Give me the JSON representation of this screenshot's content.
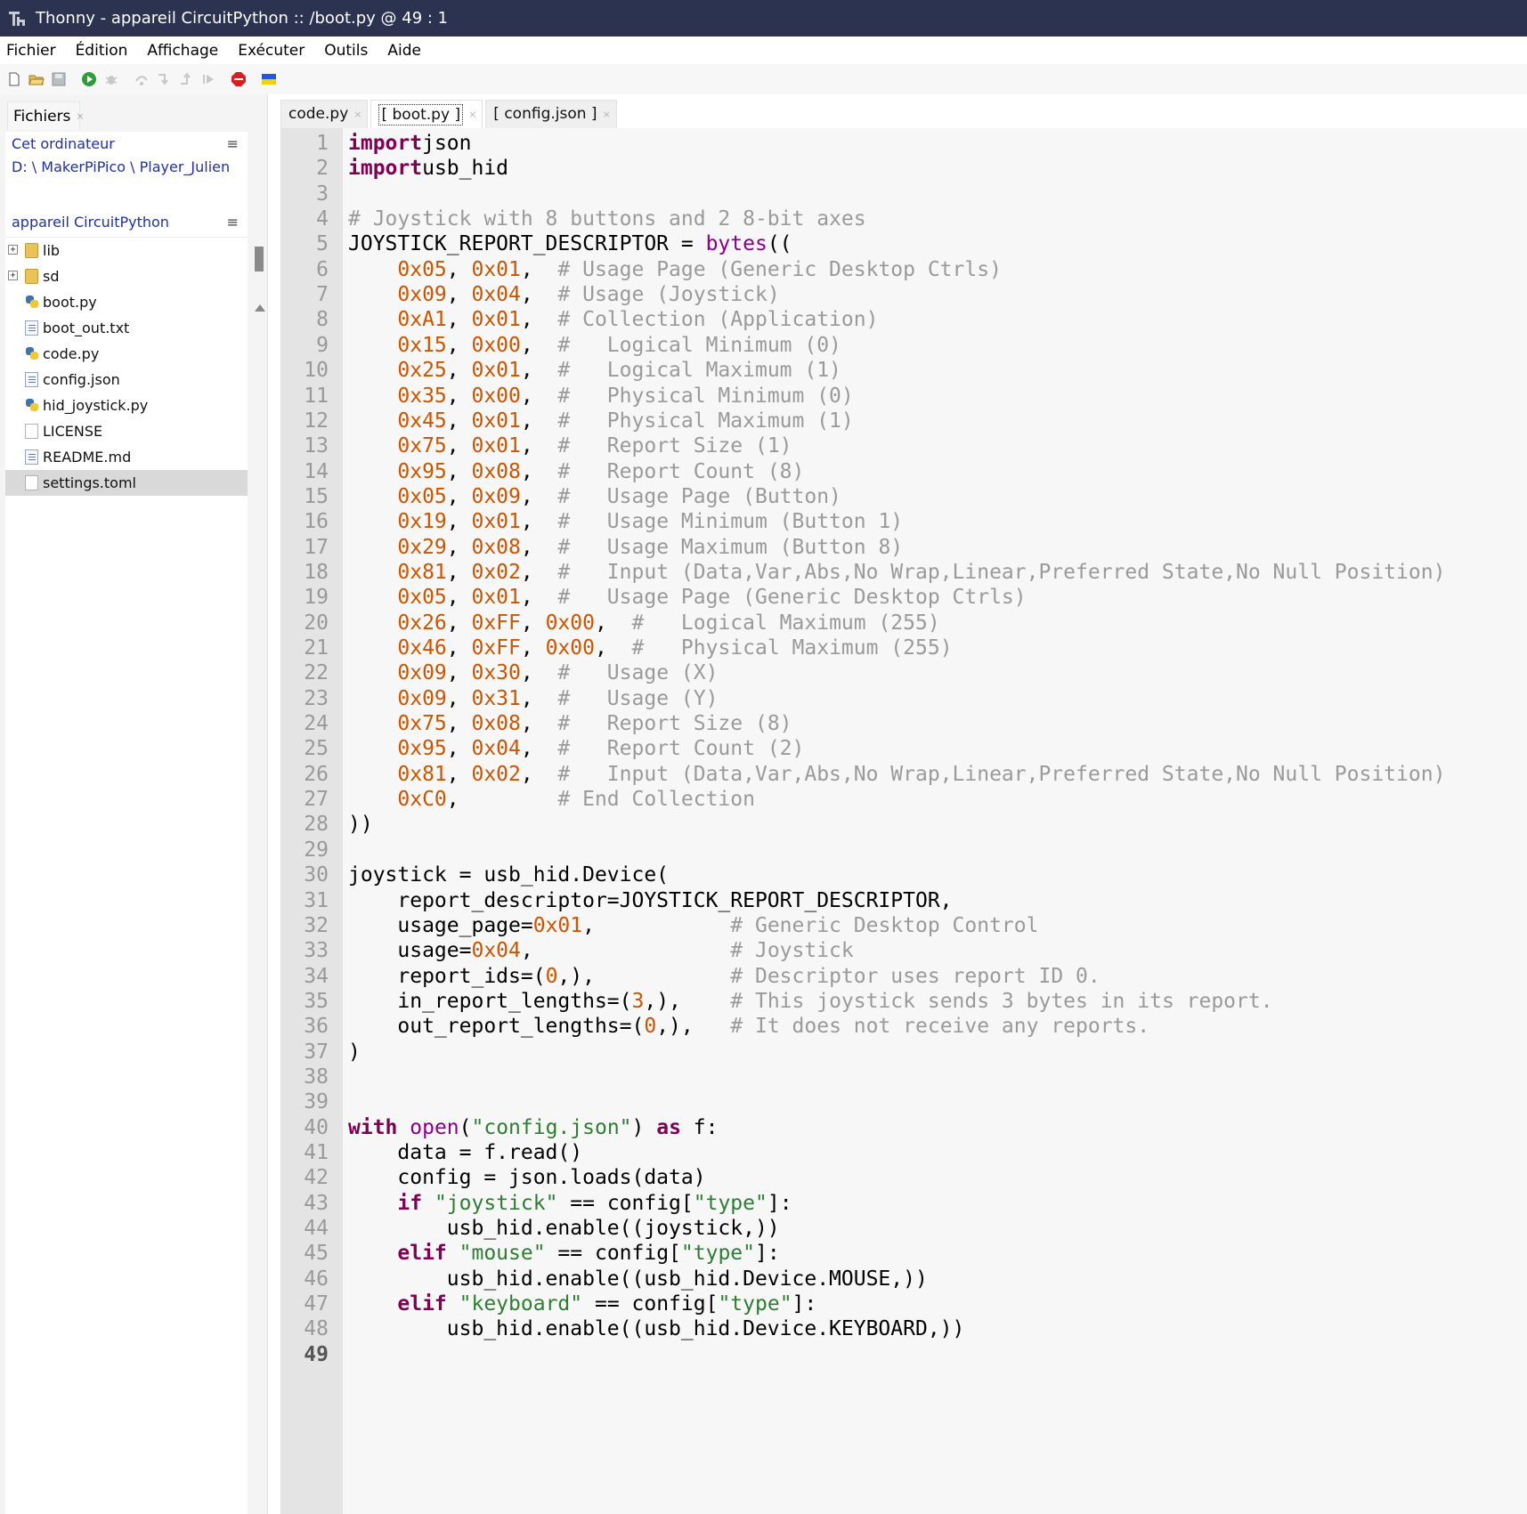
{
  "window": {
    "title": "Thonny  -  appareil CircuitPython :: /boot.py  @  49 : 1"
  },
  "menu": [
    "Fichier",
    "Édition",
    "Affichage",
    "Exécuter",
    "Outils",
    "Aide"
  ],
  "toolbar": {
    "icons": [
      "new-file-icon",
      "open-file-icon",
      "save-icon",
      "run-icon",
      "debug-icon",
      "step-over-icon",
      "step-into-icon",
      "step-out-icon",
      "resume-icon",
      "stop-icon",
      "ukraine-flag-icon"
    ]
  },
  "files_panel": {
    "tab_label": "Fichiers",
    "tab_close": "×",
    "local": {
      "title": "Cet ordinateur",
      "path": "D: \\ MakerPiPico \\ Player_Julien",
      "menu": "≡"
    },
    "device": {
      "title": "appareil CircuitPython",
      "menu": "≡",
      "items": [
        {
          "name": "lib",
          "type": "folder",
          "expander": "+"
        },
        {
          "name": "sd",
          "type": "folder",
          "expander": "+"
        },
        {
          "name": "boot.py",
          "type": "py"
        },
        {
          "name": "boot_out.txt",
          "type": "doc"
        },
        {
          "name": "code.py",
          "type": "py"
        },
        {
          "name": "config.json",
          "type": "doc"
        },
        {
          "name": "hid_joystick.py",
          "type": "py"
        },
        {
          "name": "LICENSE",
          "type": "blank"
        },
        {
          "name": "README.md",
          "type": "doc"
        },
        {
          "name": "settings.toml",
          "type": "blank",
          "selected": true
        }
      ]
    }
  },
  "editor": {
    "tabs": [
      {
        "label": "code.py",
        "active": false,
        "close": "×"
      },
      {
        "label": "[ boot.py ]",
        "active": true,
        "close": "×"
      },
      {
        "label": "[ config.json ]",
        "active": false,
        "close": "×"
      }
    ],
    "current_line": 49,
    "lines": [
      [
        [
          "kw",
          "import"
        ],
        [
          "",
          "json"
        ]
      ],
      [
        [
          "kw",
          "import"
        ],
        [
          "",
          "usb_hid"
        ]
      ],
      [],
      [
        [
          "cmt",
          "# Joystick with 8 buttons and 2 8-bit axes"
        ]
      ],
      [
        [
          "",
          "JOYSTICK_REPORT_DESCRIPTOR = "
        ],
        [
          "bi",
          "bytes"
        ],
        [
          "",
          "(("
        ]
      ],
      [
        [
          "",
          "    "
        ],
        [
          "num",
          "0x05"
        ],
        [
          "",
          ", "
        ],
        [
          "num",
          "0x01"
        ],
        [
          "",
          ",  "
        ],
        [
          "cmt",
          "# Usage Page (Generic Desktop Ctrls)"
        ]
      ],
      [
        [
          "",
          "    "
        ],
        [
          "num",
          "0x09"
        ],
        [
          "",
          ", "
        ],
        [
          "num",
          "0x04"
        ],
        [
          "",
          ",  "
        ],
        [
          "cmt",
          "# Usage (Joystick)"
        ]
      ],
      [
        [
          "",
          "    "
        ],
        [
          "num",
          "0xA1"
        ],
        [
          "",
          ", "
        ],
        [
          "num",
          "0x01"
        ],
        [
          "",
          ",  "
        ],
        [
          "cmt",
          "# Collection (Application)"
        ]
      ],
      [
        [
          "",
          "    "
        ],
        [
          "num",
          "0x15"
        ],
        [
          "",
          ", "
        ],
        [
          "num",
          "0x00"
        ],
        [
          "",
          ",  "
        ],
        [
          "cmt",
          "#   Logical Minimum (0)"
        ]
      ],
      [
        [
          "",
          "    "
        ],
        [
          "num",
          "0x25"
        ],
        [
          "",
          ", "
        ],
        [
          "num",
          "0x01"
        ],
        [
          "",
          ",  "
        ],
        [
          "cmt",
          "#   Logical Maximum (1)"
        ]
      ],
      [
        [
          "",
          "    "
        ],
        [
          "num",
          "0x35"
        ],
        [
          "",
          ", "
        ],
        [
          "num",
          "0x00"
        ],
        [
          "",
          ",  "
        ],
        [
          "cmt",
          "#   Physical Minimum (0)"
        ]
      ],
      [
        [
          "",
          "    "
        ],
        [
          "num",
          "0x45"
        ],
        [
          "",
          ", "
        ],
        [
          "num",
          "0x01"
        ],
        [
          "",
          ",  "
        ],
        [
          "cmt",
          "#   Physical Maximum (1)"
        ]
      ],
      [
        [
          "",
          "    "
        ],
        [
          "num",
          "0x75"
        ],
        [
          "",
          ", "
        ],
        [
          "num",
          "0x01"
        ],
        [
          "",
          ",  "
        ],
        [
          "cmt",
          "#   Report Size (1)"
        ]
      ],
      [
        [
          "",
          "    "
        ],
        [
          "num",
          "0x95"
        ],
        [
          "",
          ", "
        ],
        [
          "num",
          "0x08"
        ],
        [
          "",
          ",  "
        ],
        [
          "cmt",
          "#   Report Count (8)"
        ]
      ],
      [
        [
          "",
          "    "
        ],
        [
          "num",
          "0x05"
        ],
        [
          "",
          ", "
        ],
        [
          "num",
          "0x09"
        ],
        [
          "",
          ",  "
        ],
        [
          "cmt",
          "#   Usage Page (Button)"
        ]
      ],
      [
        [
          "",
          "    "
        ],
        [
          "num",
          "0x19"
        ],
        [
          "",
          ", "
        ],
        [
          "num",
          "0x01"
        ],
        [
          "",
          ",  "
        ],
        [
          "cmt",
          "#   Usage Minimum (Button 1)"
        ]
      ],
      [
        [
          "",
          "    "
        ],
        [
          "num",
          "0x29"
        ],
        [
          "",
          ", "
        ],
        [
          "num",
          "0x08"
        ],
        [
          "",
          ",  "
        ],
        [
          "cmt",
          "#   Usage Maximum (Button 8)"
        ]
      ],
      [
        [
          "",
          "    "
        ],
        [
          "num",
          "0x81"
        ],
        [
          "",
          ", "
        ],
        [
          "num",
          "0x02"
        ],
        [
          "",
          ",  "
        ],
        [
          "cmt",
          "#   Input (Data,Var,Abs,No Wrap,Linear,Preferred State,No Null Position)"
        ]
      ],
      [
        [
          "",
          "    "
        ],
        [
          "num",
          "0x05"
        ],
        [
          "",
          ", "
        ],
        [
          "num",
          "0x01"
        ],
        [
          "",
          ",  "
        ],
        [
          "cmt",
          "#   Usage Page (Generic Desktop Ctrls)"
        ]
      ],
      [
        [
          "",
          "    "
        ],
        [
          "num",
          "0x26"
        ],
        [
          "",
          ", "
        ],
        [
          "num",
          "0xFF"
        ],
        [
          "",
          ", "
        ],
        [
          "num",
          "0x00"
        ],
        [
          "",
          ",  "
        ],
        [
          "cmt",
          "#   Logical Maximum (255)"
        ]
      ],
      [
        [
          "",
          "    "
        ],
        [
          "num",
          "0x46"
        ],
        [
          "",
          ", "
        ],
        [
          "num",
          "0xFF"
        ],
        [
          "",
          ", "
        ],
        [
          "num",
          "0x00"
        ],
        [
          "",
          ",  "
        ],
        [
          "cmt",
          "#   Physical Maximum (255)"
        ]
      ],
      [
        [
          "",
          "    "
        ],
        [
          "num",
          "0x09"
        ],
        [
          "",
          ", "
        ],
        [
          "num",
          "0x30"
        ],
        [
          "",
          ",  "
        ],
        [
          "cmt",
          "#   Usage (X)"
        ]
      ],
      [
        [
          "",
          "    "
        ],
        [
          "num",
          "0x09"
        ],
        [
          "",
          ", "
        ],
        [
          "num",
          "0x31"
        ],
        [
          "",
          ",  "
        ],
        [
          "cmt",
          "#   Usage (Y)"
        ]
      ],
      [
        [
          "",
          "    "
        ],
        [
          "num",
          "0x75"
        ],
        [
          "",
          ", "
        ],
        [
          "num",
          "0x08"
        ],
        [
          "",
          ",  "
        ],
        [
          "cmt",
          "#   Report Size (8)"
        ]
      ],
      [
        [
          "",
          "    "
        ],
        [
          "num",
          "0x95"
        ],
        [
          "",
          ", "
        ],
        [
          "num",
          "0x04"
        ],
        [
          "",
          ",  "
        ],
        [
          "cmt",
          "#   Report Count (2)"
        ]
      ],
      [
        [
          "",
          "    "
        ],
        [
          "num",
          "0x81"
        ],
        [
          "",
          ", "
        ],
        [
          "num",
          "0x02"
        ],
        [
          "",
          ",  "
        ],
        [
          "cmt",
          "#   Input (Data,Var,Abs,No Wrap,Linear,Preferred State,No Null Position)"
        ]
      ],
      [
        [
          "",
          "    "
        ],
        [
          "num",
          "0xC0"
        ],
        [
          "",
          ",        "
        ],
        [
          "cmt",
          "# End Collection"
        ]
      ],
      [
        [
          "",
          "))"
        ]
      ],
      [],
      [
        [
          "",
          "joystick = usb_hid.Device("
        ]
      ],
      [
        [
          "",
          "    report_descriptor=JOYSTICK_REPORT_DESCRIPTOR,"
        ]
      ],
      [
        [
          "",
          "    usage_page="
        ],
        [
          "num",
          "0x01"
        ],
        [
          "",
          ",           "
        ],
        [
          "cmt",
          "# Generic Desktop Control"
        ]
      ],
      [
        [
          "",
          "    usage="
        ],
        [
          "num",
          "0x04"
        ],
        [
          "",
          ",                "
        ],
        [
          "cmt",
          "# Joystick"
        ]
      ],
      [
        [
          "",
          "    report_ids=("
        ],
        [
          "num",
          "0"
        ],
        [
          "",
          ",),           "
        ],
        [
          "cmt",
          "# Descriptor uses report ID 0."
        ]
      ],
      [
        [
          "",
          "    in_report_lengths=("
        ],
        [
          "num",
          "3"
        ],
        [
          "",
          ",),    "
        ],
        [
          "cmt",
          "# This joystick sends 3 bytes in its report."
        ]
      ],
      [
        [
          "",
          "    out_report_lengths=("
        ],
        [
          "num",
          "0"
        ],
        [
          "",
          ",),   "
        ],
        [
          "cmt",
          "# It does not receive any reports."
        ]
      ],
      [
        [
          "",
          ")"
        ]
      ],
      [],
      [],
      [
        [
          "kw",
          "with"
        ],
        [
          "",
          " "
        ],
        [
          "bi",
          "open"
        ],
        [
          "",
          "("
        ],
        [
          "str",
          "\"config.json\""
        ],
        [
          "",
          ") "
        ],
        [
          "kw",
          "as"
        ],
        [
          "",
          " f:"
        ]
      ],
      [
        [
          "",
          "    data = f.read()"
        ]
      ],
      [
        [
          "",
          "    config = json.loads(data)"
        ]
      ],
      [
        [
          "",
          "    "
        ],
        [
          "kw",
          "if"
        ],
        [
          "",
          " "
        ],
        [
          "str",
          "\"joystick\""
        ],
        [
          "",
          " == config["
        ],
        [
          "str",
          "\"type\""
        ],
        [
          "",
          "]:"
        ]
      ],
      [
        [
          "",
          "        usb_hid.enable((joystick,))"
        ]
      ],
      [
        [
          "",
          "    "
        ],
        [
          "kw",
          "elif"
        ],
        [
          "",
          " "
        ],
        [
          "str",
          "\"mouse\""
        ],
        [
          "",
          " == config["
        ],
        [
          "str",
          "\"type\""
        ],
        [
          "",
          "]:"
        ]
      ],
      [
        [
          "",
          "        usb_hid.enable((usb_hid.Device.MOUSE,))"
        ]
      ],
      [
        [
          "",
          "    "
        ],
        [
          "kw",
          "elif"
        ],
        [
          "",
          " "
        ],
        [
          "str",
          "\"keyboard\""
        ],
        [
          "",
          " == config["
        ],
        [
          "str",
          "\"type\""
        ],
        [
          "",
          "]:"
        ]
      ],
      [
        [
          "",
          "        usb_hid.enable((usb_hid.Device.KEYBOARD,))"
        ]
      ],
      []
    ]
  },
  "colors": {
    "titlebar_bg": "#2b3350",
    "keyword": "#7f0055",
    "number": "#cc5500",
    "comment": "#9a9a9a",
    "string": "#2e7d32",
    "builtin": "#8b008b",
    "panel_link": "#23319a"
  }
}
